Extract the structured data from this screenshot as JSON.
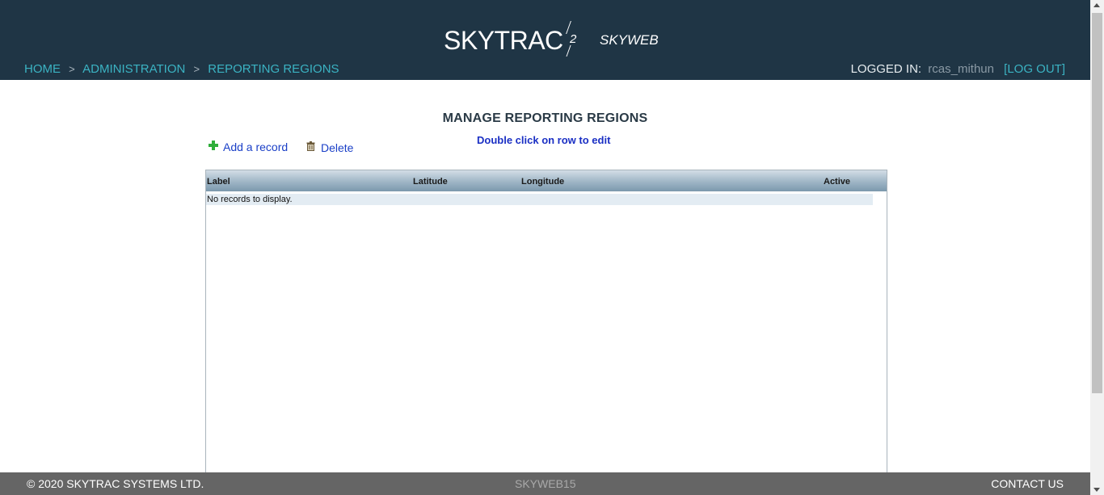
{
  "header": {
    "logo_text": "SKYTRAC",
    "logo_mark": "2",
    "product_name": "SKYWEB",
    "breadcrumb": [
      "HOME",
      "ADMINISTRATION",
      "REPORTING REGIONS"
    ],
    "breadcrumb_separator": ">",
    "logged_in_label": "LOGGED IN:",
    "username": "rcas_mithun",
    "logout_label": "[LOG OUT]"
  },
  "main": {
    "title": "MANAGE REPORTING REGIONS",
    "add_record_label": "Add a record",
    "delete_label": "Delete",
    "edit_hint": "Double click on row to edit",
    "grid": {
      "columns": [
        "Label",
        "Latitude",
        "Longitude",
        "Active"
      ],
      "empty_message": "No records to display."
    }
  },
  "footer": {
    "copyright": "© 2020 SKYTRAC SYSTEMS LTD.",
    "server": "SKYWEB15",
    "contact_label": "CONTACT US"
  },
  "icons": {
    "add": "plus-icon",
    "delete": "trash-icon"
  },
  "colors": {
    "header_bg": "#1f3545",
    "link_teal": "#3bb3c3",
    "link_blue": "#1a3fc7",
    "footer_bg": "#656565",
    "add_icon_green": "#2fae3a"
  }
}
